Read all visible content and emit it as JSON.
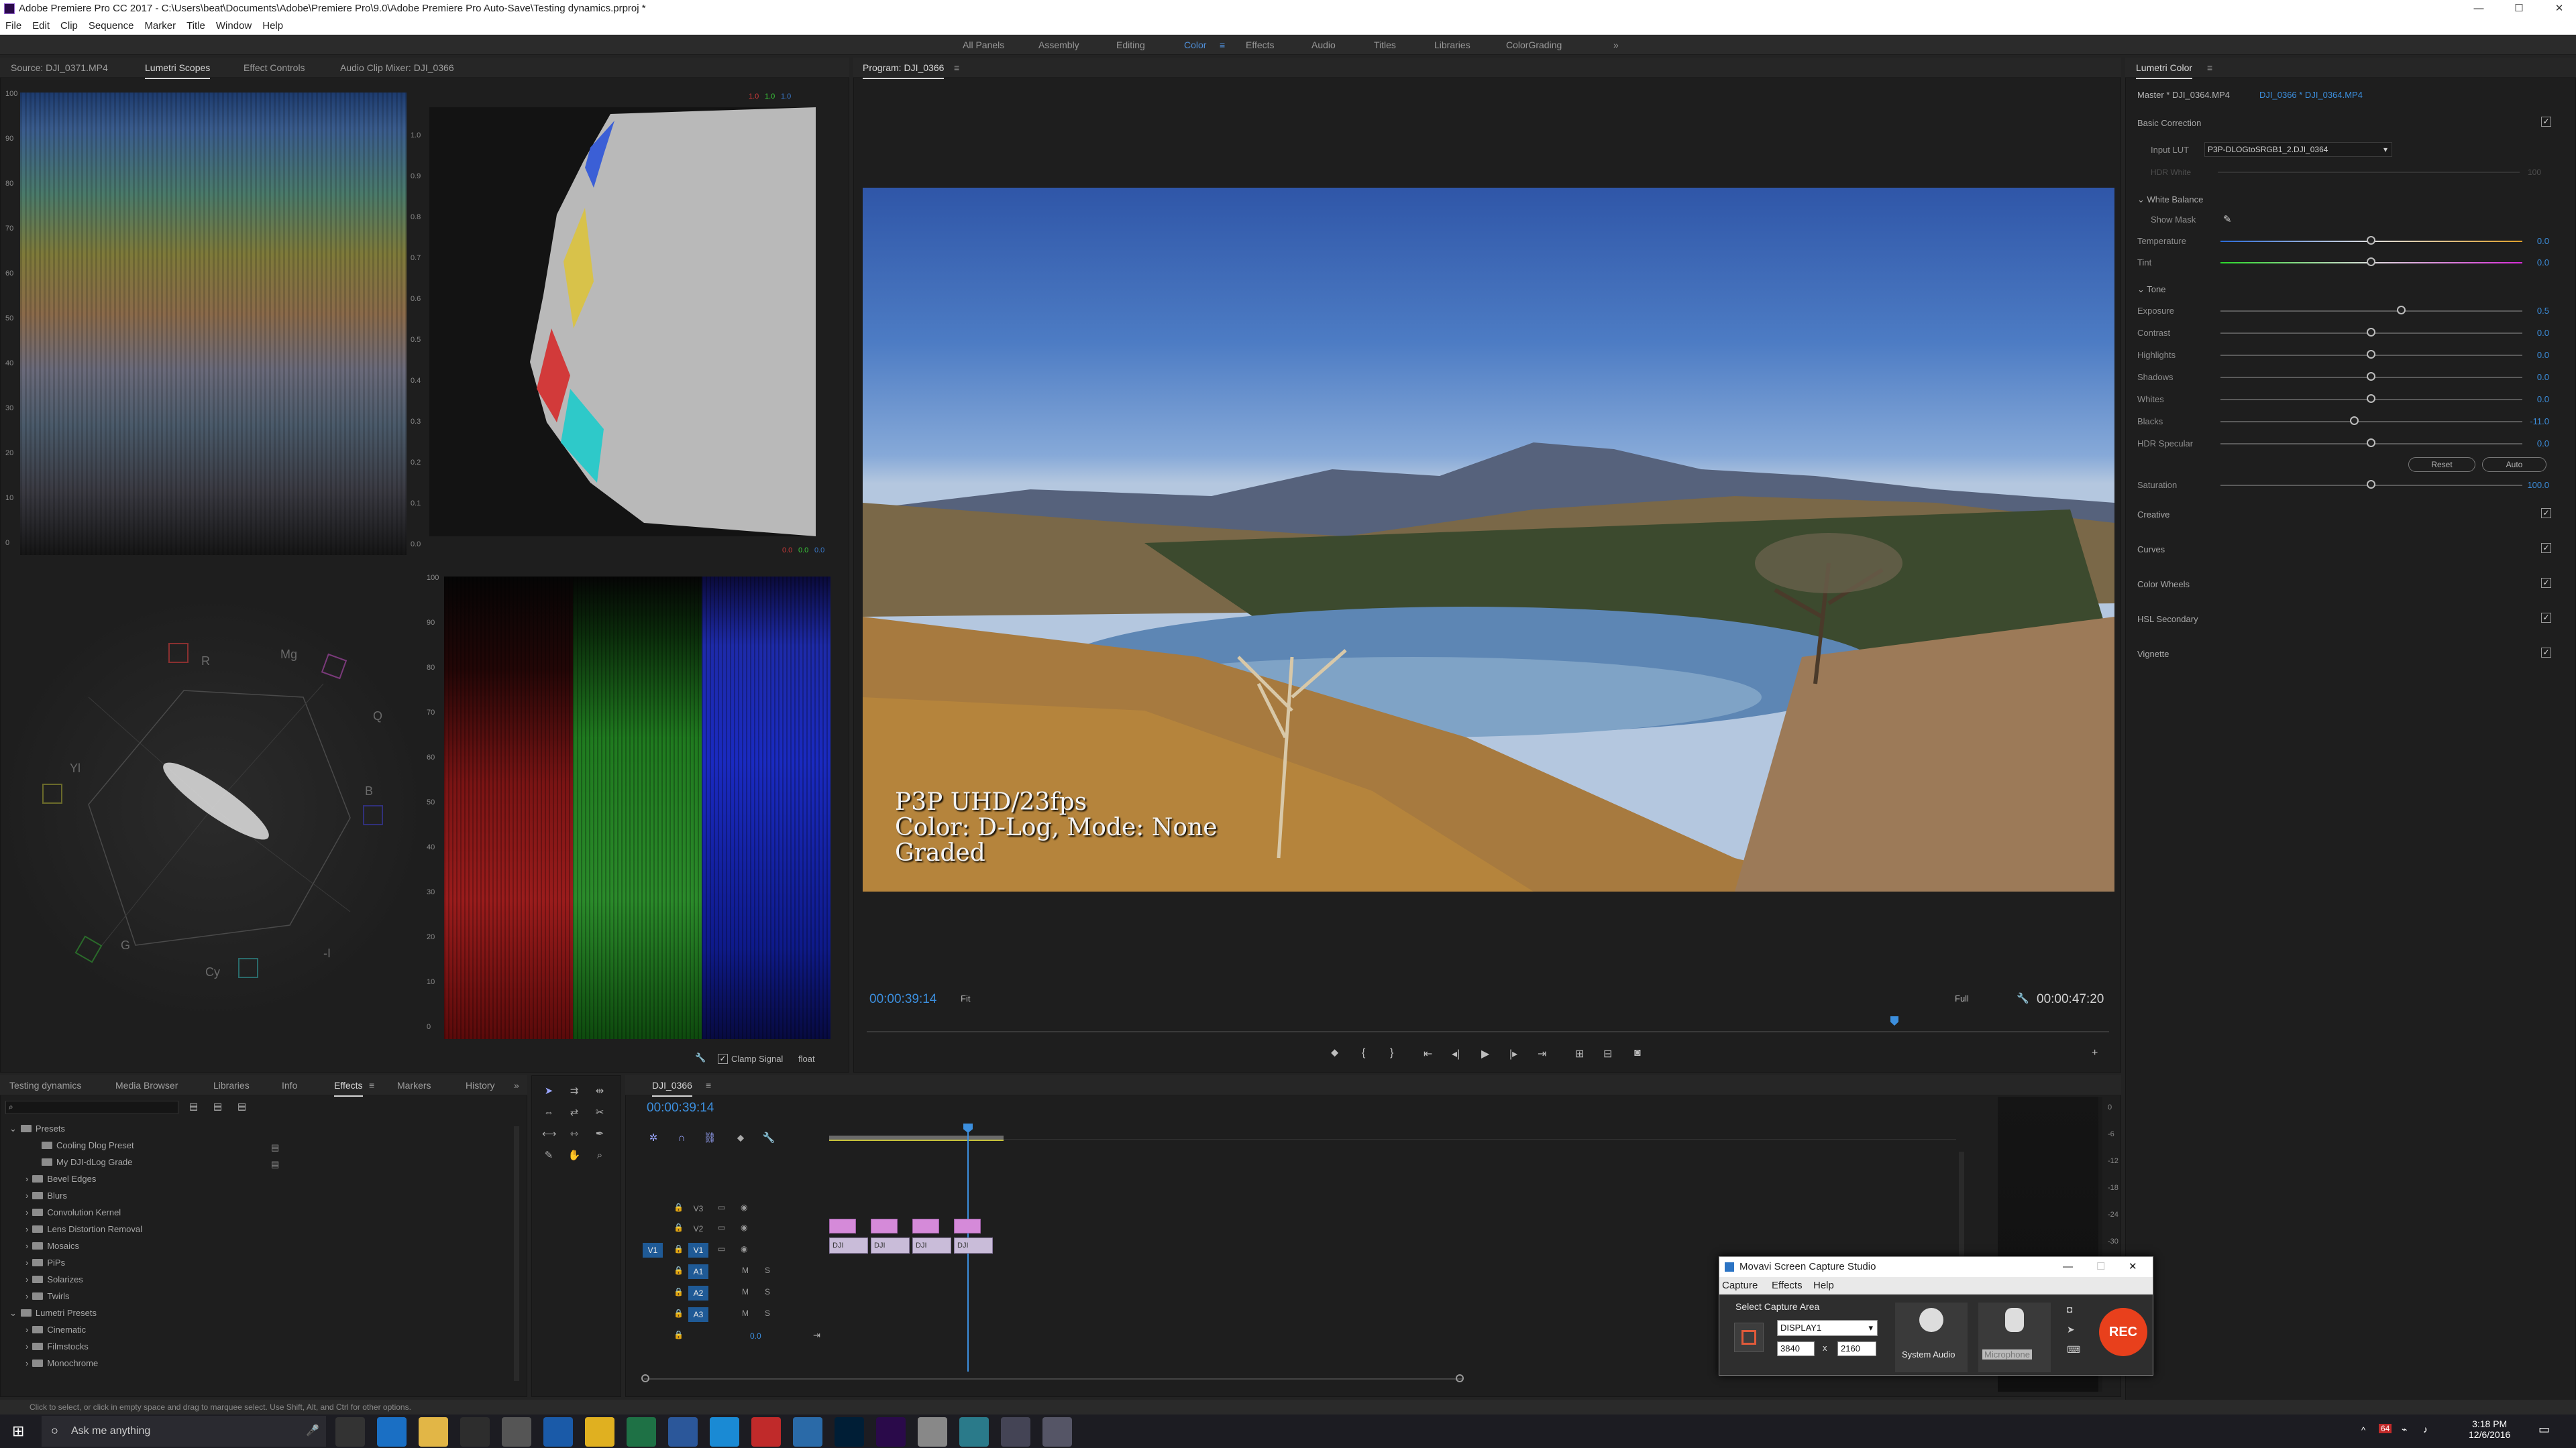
{
  "window": {
    "title": "Adobe Premiere Pro CC 2017 - C:\\Users\\beat\\Documents\\Adobe\\Premiere Pro\\9.0\\Adobe Premiere Pro Auto-Save\\Testing dynamics.prproj *",
    "minimize": "—",
    "maximize": "☐",
    "close": "✕"
  },
  "menu": [
    "File",
    "Edit",
    "Clip",
    "Sequence",
    "Marker",
    "Title",
    "Window",
    "Help"
  ],
  "workspaces": {
    "items": [
      "All Panels",
      "Assembly",
      "Editing",
      "Color",
      "Effects",
      "Audio",
      "Titles",
      "Libraries",
      "ColorGrading"
    ],
    "active": "Color",
    "more": "»"
  },
  "scopes": {
    "tabs": [
      "Source: DJI_0371.MP4",
      "Lumetri Scopes",
      "Effect Controls",
      "Audio Clip Mixer: DJI_0366"
    ],
    "active_tab": "Lumetri Scopes",
    "wave_ticks": [
      "100",
      "90",
      "80",
      "70",
      "60",
      "50",
      "40",
      "30",
      "20",
      "10",
      "0"
    ],
    "hist_ticks": [
      "1.0",
      "0.9",
      "0.8",
      "0.7",
      "0.6",
      "0.5",
      "0.4",
      "0.3",
      "0.2",
      "0.1",
      "0.0"
    ],
    "hist_top": [
      "1.0",
      "1.0",
      "1.0"
    ],
    "hist_bottom": [
      "0.0",
      "0.0",
      "0.0"
    ],
    "parade_ticks": [
      "100",
      "90",
      "80",
      "70",
      "60",
      "50",
      "40",
      "30",
      "20",
      "10",
      "0"
    ],
    "vector_labels": {
      "r": "R",
      "mg": "Mg",
      "b": "B",
      "cy": "Cy",
      "g": "G",
      "yl": "Yl",
      "i": "I",
      "q": "Q",
      "neg_i": "-I"
    },
    "clamp_signal": "Clamp Signal",
    "float": "float"
  },
  "program": {
    "title": "Program: DJI_0366",
    "timecode_left": "00:00:39:14",
    "fit": "Fit",
    "quality": "Full",
    "timecode_right": "00:00:47:20",
    "overlay": [
      "P3P UHD/23fps",
      "Color: D-Log, Mode: None",
      "Graded"
    ]
  },
  "lumetri": {
    "title": "Lumetri Color",
    "master": "Master * DJI_0364.MP4",
    "clip": "DJI_0366 * DJI_0364.MP4",
    "basic_correction": "Basic Correction",
    "input_lut_label": "Input LUT",
    "input_lut": "P3P-DLOGtoSRGB1_2.DJI_0364",
    "hdr_white": "HDR White",
    "hdr_white_val": "100",
    "white_balance": "White Balance",
    "show_mask": "Show Mask",
    "wb": [
      {
        "label": "Temperature",
        "value": "0.0",
        "pos": 0.5
      },
      {
        "label": "Tint",
        "value": "0.0",
        "pos": 0.5
      }
    ],
    "tone": "Tone",
    "tone_rows": [
      {
        "label": "Exposure",
        "value": "0.5",
        "pos": 0.6
      },
      {
        "label": "Contrast",
        "value": "0.0",
        "pos": 0.5
      },
      {
        "label": "Highlights",
        "value": "0.0",
        "pos": 0.5
      },
      {
        "label": "Shadows",
        "value": "0.0",
        "pos": 0.5
      },
      {
        "label": "Whites",
        "value": "0.0",
        "pos": 0.5
      },
      {
        "label": "Blacks",
        "value": "-11.0",
        "pos": 0.445
      },
      {
        "label": "HDR Specular",
        "value": "0.0",
        "pos": 0.5
      }
    ],
    "reset": "Reset",
    "auto": "Auto",
    "saturation": {
      "label": "Saturation",
      "value": "100.0",
      "pos": 0.5
    },
    "sections": [
      "Creative",
      "Curves",
      "Color Wheels",
      "HSL Secondary",
      "Vignette"
    ]
  },
  "project": {
    "tabs": [
      "Testing dynamics",
      "Media Browser",
      "Libraries",
      "Info",
      "Effects",
      "Markers",
      "History"
    ],
    "active_tab": "Effects",
    "tree": [
      {
        "label": "Presets",
        "indent": 0,
        "open": true
      },
      {
        "label": "Cooling Dlog Preset",
        "indent": 2
      },
      {
        "label": "My DJI-dLog Grade",
        "indent": 2
      },
      {
        "label": "Bevel Edges",
        "indent": 1
      },
      {
        "label": "Blurs",
        "indent": 1
      },
      {
        "label": "Convolution Kernel",
        "indent": 1
      },
      {
        "label": "Lens Distortion Removal",
        "indent": 1
      },
      {
        "label": "Mosaics",
        "indent": 1
      },
      {
        "label": "PiPs",
        "indent": 1
      },
      {
        "label": "Solarizes",
        "indent": 1
      },
      {
        "label": "Twirls",
        "indent": 1
      },
      {
        "label": "Lumetri Presets",
        "indent": 0,
        "open": true
      },
      {
        "label": "Cinematic",
        "indent": 1
      },
      {
        "label": "Filmstocks",
        "indent": 1
      },
      {
        "label": "Monochrome",
        "indent": 1
      }
    ]
  },
  "timeline": {
    "title": "DJI_0366",
    "timecode": "00:00:39:14",
    "tracks": [
      "V3",
      "V2",
      "V1",
      "A1",
      "A2",
      "A3"
    ],
    "src_v1": "V1",
    "offset": "0.0",
    "clips": [
      "DJI",
      "DJI",
      "DJI",
      "DJI"
    ],
    "meter_ticks": [
      "0",
      "-6",
      "-12",
      "-18",
      "-24",
      "-30"
    ]
  },
  "status": "Click to select, or click in empty space and drag to marquee select. Use Shift, Alt, and Ctrl for other options.",
  "movavi": {
    "title": "Movavi Screen Capture Studio",
    "menu": [
      "Capture",
      "Effects",
      "Help"
    ],
    "select_area": "Select Capture Area",
    "display": "DISPLAY1",
    "width": "3840",
    "x": "x",
    "height": "2160",
    "system_audio": "System Audio",
    "microphone": "Microphone",
    "rec": "REC"
  },
  "taskbar": {
    "search": "Ask me anything",
    "time": "3:18 PM",
    "date": "12/6/2016",
    "badge": "64"
  }
}
